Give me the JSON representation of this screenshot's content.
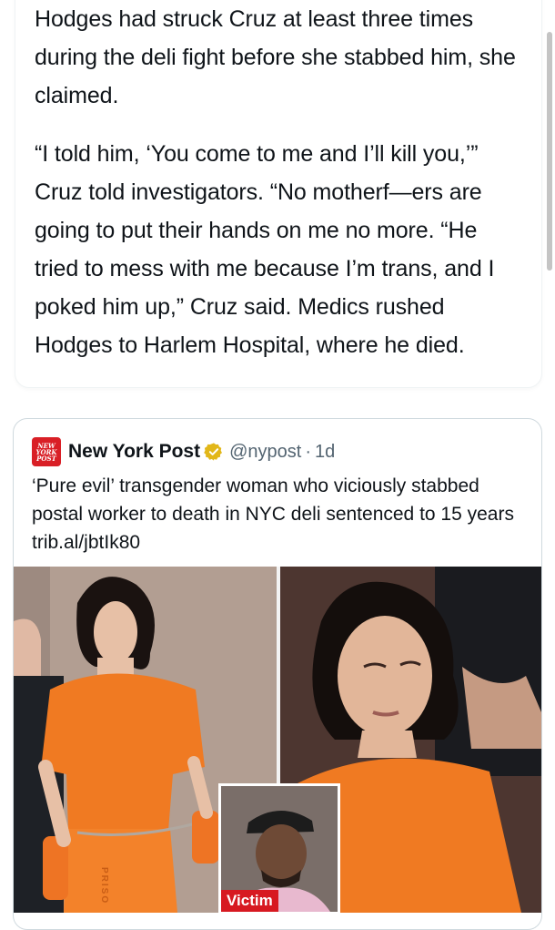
{
  "post": {
    "paragraph_1": "Hodges had struck Cruz at least three times during the deli fight before she stabbed him, she claimed.",
    "paragraph_2": "“I told him, ‘You come to me and I’ll kill you,’” Cruz told investigators. “No motherf—ers are going to put their hands on me no more. “He tried to mess with me because I’m trans, and I poked him up,” Cruz said. Medics rushed Hodges to Harlem Hospital, where he died."
  },
  "quoted_tweet": {
    "logo_text": [
      "NEW",
      "YORK",
      "POST"
    ],
    "author_name": "New York Post",
    "verified": true,
    "handle": "@nypost",
    "separator": "·",
    "time": "1d",
    "text": "‘Pure evil’ transgender woman who viciously stabbed postal worker to death in NYC deli sentenced to 15 years trib.al/jbtIk80",
    "image": {
      "inset_label": "Victim",
      "jumpsuit_text": "PRISO"
    }
  },
  "colors": {
    "accent_red": "#d71921",
    "verified_gold": "#e2b719",
    "jumpsuit_orange": "#f07a22"
  }
}
